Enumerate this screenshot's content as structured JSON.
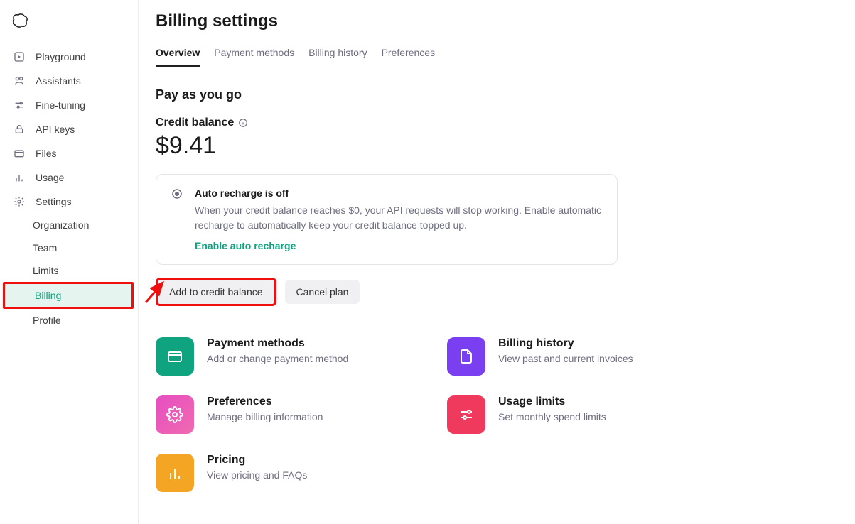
{
  "sidebar": {
    "items": [
      {
        "id": "playground",
        "label": "Playground"
      },
      {
        "id": "assistants",
        "label": "Assistants"
      },
      {
        "id": "fine-tuning",
        "label": "Fine-tuning"
      },
      {
        "id": "api-keys",
        "label": "API keys"
      },
      {
        "id": "files",
        "label": "Files"
      },
      {
        "id": "usage",
        "label": "Usage"
      },
      {
        "id": "settings",
        "label": "Settings"
      }
    ],
    "sub_items": [
      {
        "id": "organization",
        "label": "Organization"
      },
      {
        "id": "team",
        "label": "Team"
      },
      {
        "id": "limits",
        "label": "Limits"
      },
      {
        "id": "billing",
        "label": "Billing"
      },
      {
        "id": "profile",
        "label": "Profile"
      }
    ]
  },
  "page": {
    "title": "Billing settings",
    "tabs": [
      {
        "id": "overview",
        "label": "Overview"
      },
      {
        "id": "payment-methods",
        "label": "Payment methods"
      },
      {
        "id": "billing-history",
        "label": "Billing history"
      },
      {
        "id": "preferences",
        "label": "Preferences"
      }
    ]
  },
  "overview": {
    "section_title": "Pay as you go",
    "balance_label": "Credit balance",
    "balance_amount": "$9.41",
    "recharge": {
      "title": "Auto recharge is off",
      "desc": "When your credit balance reaches $0, your API requests will stop working. Enable automatic recharge to automatically keep your credit balance topped up.",
      "link": "Enable auto recharge"
    },
    "buttons": {
      "add_credit": "Add to credit balance",
      "cancel_plan": "Cancel plan"
    },
    "cards": [
      {
        "id": "payment-methods",
        "title": "Payment methods",
        "sub": "Add or change payment method",
        "color": "#10a37f"
      },
      {
        "id": "billing-history",
        "title": "Billing history",
        "sub": "View past and current invoices",
        "color": "#7b3ff2"
      },
      {
        "id": "preferences",
        "title": "Preferences",
        "sub": "Manage billing information",
        "color": "#e64ec1"
      },
      {
        "id": "usage-limits",
        "title": "Usage limits",
        "sub": "Set monthly spend limits",
        "color": "#ef3a5d"
      },
      {
        "id": "pricing",
        "title": "Pricing",
        "sub": "View pricing and FAQs",
        "color": "#f5a524"
      }
    ]
  },
  "annotations": {
    "highlight_sidebar_item": "billing",
    "highlight_button": "add_credit"
  }
}
